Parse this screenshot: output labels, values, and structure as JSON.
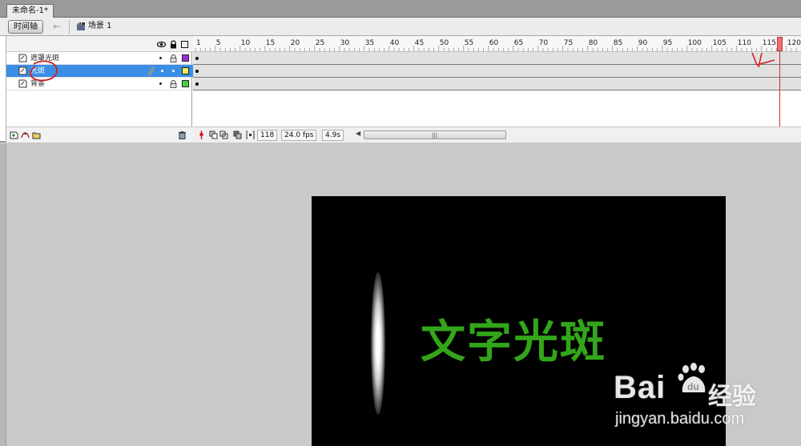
{
  "document": {
    "tab_title": "未命名-1*"
  },
  "toolbar": {
    "timeline_button": "时间轴",
    "scene_label": "场景 1"
  },
  "layers": [
    {
      "name": "遮罩光斑",
      "swatch_color": "#9b30d9",
      "selected": false
    },
    {
      "name": "光斑",
      "swatch_color": "#f4f050",
      "selected": true
    },
    {
      "name": "背景",
      "swatch_color": "#3ed23e",
      "selected": false
    }
  ],
  "ruler": {
    "labels": [
      "1",
      "5",
      "10",
      "15",
      "20",
      "25",
      "30",
      "35",
      "40",
      "45",
      "50",
      "55",
      "60",
      "65",
      "70",
      "75",
      "80",
      "85",
      "90",
      "95",
      "100",
      "105",
      "110",
      "115",
      "120"
    ]
  },
  "status": {
    "current_frame": "118",
    "frame_rate": "24.0 fps",
    "elapsed": "4.9s"
  },
  "stage": {
    "text": "文字光斑",
    "text_color": "#33a51a",
    "background": "#000000"
  },
  "watermark": {
    "brand": "Bai",
    "suffix": "经验",
    "url": "jingyan.baidu.com",
    "paw": "du"
  },
  "annotations": {
    "ink_color": "#d21e1e"
  }
}
